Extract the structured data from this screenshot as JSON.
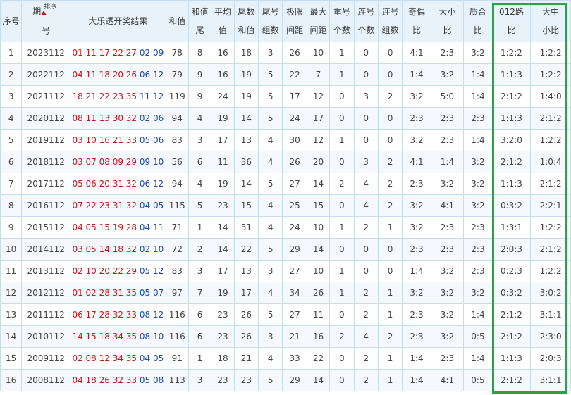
{
  "headers": [
    [
      "序号"
    ],
    [
      "期",
      "号"
    ],
    [
      "大乐透开奖结果"
    ],
    [
      "和值"
    ],
    [
      "和值",
      "尾"
    ],
    [
      "平均",
      "值"
    ],
    [
      "尾数",
      "和值"
    ],
    [
      "尾号",
      "组数"
    ],
    [
      "极限",
      "间距"
    ],
    [
      "最大",
      "间距"
    ],
    [
      "重号",
      "个数"
    ],
    [
      "连号",
      "个数"
    ],
    [
      "连号",
      "组数"
    ],
    [
      "奇偶",
      "比"
    ],
    [
      "大小",
      "比"
    ],
    [
      "质合",
      "比"
    ],
    [
      "012路",
      "比"
    ],
    [
      "大中",
      "小比"
    ]
  ],
  "sort_label": "排序",
  "rows": [
    {
      "no": "1",
      "issue": "2023112",
      "red": "01 11 17 22 27",
      "blue": "02 09",
      "sum": "78",
      "sum_tail": "8",
      "avg": "16",
      "tail_sum": "18",
      "tail_groups": "3",
      "limit_gap": "26",
      "max_gap": "10",
      "repeat": "1",
      "consec": "0",
      "consec_groups": "0",
      "odd_even": "4:1",
      "big_small": "2:3",
      "prime": "3:2",
      "r012": "1:2:2",
      "bms": "1:2:2"
    },
    {
      "no": "2",
      "issue": "2022112",
      "red": "04 11 18 20 26",
      "blue": "06 12",
      "sum": "79",
      "sum_tail": "9",
      "avg": "16",
      "tail_sum": "19",
      "tail_groups": "5",
      "limit_gap": "22",
      "max_gap": "7",
      "repeat": "1",
      "consec": "0",
      "consec_groups": "0",
      "odd_even": "1:4",
      "big_small": "3:2",
      "prime": "1:4",
      "r012": "1:1:3",
      "bms": "1:2:2"
    },
    {
      "no": "3",
      "issue": "2021112",
      "red": "18 21 22 23 35",
      "blue": "11 12",
      "sum": "119",
      "sum_tail": "9",
      "avg": "24",
      "tail_sum": "19",
      "tail_groups": "5",
      "limit_gap": "17",
      "max_gap": "12",
      "repeat": "0",
      "consec": "3",
      "consec_groups": "2",
      "odd_even": "3:2",
      "big_small": "5:0",
      "prime": "1:4",
      "r012": "2:1:2",
      "bms": "1:4:0"
    },
    {
      "no": "4",
      "issue": "2020112",
      "red": "08 11 13 30 32",
      "blue": "02 06",
      "sum": "94",
      "sum_tail": "4",
      "avg": "19",
      "tail_sum": "14",
      "tail_groups": "5",
      "limit_gap": "24",
      "max_gap": "17",
      "repeat": "0",
      "consec": "0",
      "consec_groups": "0",
      "odd_even": "2:3",
      "big_small": "2:3",
      "prime": "2:3",
      "r012": "1:1:3",
      "bms": "2:1:2"
    },
    {
      "no": "5",
      "issue": "2019112",
      "red": "03 10 16 21 33",
      "blue": "05 06",
      "sum": "83",
      "sum_tail": "3",
      "avg": "17",
      "tail_sum": "13",
      "tail_groups": "4",
      "limit_gap": "30",
      "max_gap": "12",
      "repeat": "1",
      "consec": "0",
      "consec_groups": "0",
      "odd_even": "3:2",
      "big_small": "2:3",
      "prime": "1:4",
      "r012": "3:2:0",
      "bms": "1:2:2"
    },
    {
      "no": "6",
      "issue": "2018112",
      "red": "03 07 08 09 29",
      "blue": "09 10",
      "sum": "56",
      "sum_tail": "6",
      "avg": "11",
      "tail_sum": "36",
      "tail_groups": "4",
      "limit_gap": "26",
      "max_gap": "20",
      "repeat": "0",
      "consec": "3",
      "consec_groups": "2",
      "odd_even": "4:1",
      "big_small": "1:4",
      "prime": "3:2",
      "r012": "2:1:2",
      "bms": "1:0:4"
    },
    {
      "no": "7",
      "issue": "2017112",
      "red": "05 06 20 31 32",
      "blue": "06 12",
      "sum": "94",
      "sum_tail": "4",
      "avg": "19",
      "tail_sum": "14",
      "tail_groups": "5",
      "limit_gap": "27",
      "max_gap": "14",
      "repeat": "2",
      "consec": "4",
      "consec_groups": "2",
      "odd_even": "2:3",
      "big_small": "3:2",
      "prime": "3:2",
      "r012": "1:1:3",
      "bms": "2:1:2"
    },
    {
      "no": "8",
      "issue": "2016112",
      "red": "07 22 23 31 32",
      "blue": "04 05",
      "sum": "115",
      "sum_tail": "5",
      "avg": "23",
      "tail_sum": "15",
      "tail_groups": "4",
      "limit_gap": "25",
      "max_gap": "15",
      "repeat": "0",
      "consec": "4",
      "consec_groups": "2",
      "odd_even": "3:2",
      "big_small": "4:1",
      "prime": "3:2",
      "r012": "0:3:2",
      "bms": "2:2:1"
    },
    {
      "no": "9",
      "issue": "2015112",
      "red": "04 05 15 19 28",
      "blue": "04 11",
      "sum": "71",
      "sum_tail": "1",
      "avg": "14",
      "tail_sum": "31",
      "tail_groups": "4",
      "limit_gap": "24",
      "max_gap": "10",
      "repeat": "1",
      "consec": "2",
      "consec_groups": "1",
      "odd_even": "3:2",
      "big_small": "2:3",
      "prime": "2:3",
      "r012": "1:3:1",
      "bms": "1:2:2"
    },
    {
      "no": "10",
      "issue": "2014112",
      "red": "03 05 14 18 32",
      "blue": "02 10",
      "sum": "72",
      "sum_tail": "2",
      "avg": "14",
      "tail_sum": "22",
      "tail_groups": "5",
      "limit_gap": "29",
      "max_gap": "14",
      "repeat": "0",
      "consec": "0",
      "consec_groups": "0",
      "odd_even": "2:3",
      "big_small": "2:3",
      "prime": "2:3",
      "r012": "2:0:3",
      "bms": "2:1:2"
    },
    {
      "no": "11",
      "issue": "2013112",
      "red": "02 10 20 22 29",
      "blue": "05 12",
      "sum": "83",
      "sum_tail": "3",
      "avg": "17",
      "tail_sum": "13",
      "tail_groups": "3",
      "limit_gap": "27",
      "max_gap": "10",
      "repeat": "1",
      "consec": "0",
      "consec_groups": "0",
      "odd_even": "1:4",
      "big_small": "3:2",
      "prime": "2:3",
      "r012": "0:2:3",
      "bms": "1:2:2"
    },
    {
      "no": "12",
      "issue": "2012112",
      "red": "01 02 28 31 35",
      "blue": "05 07",
      "sum": "97",
      "sum_tail": "7",
      "avg": "19",
      "tail_sum": "17",
      "tail_groups": "4",
      "limit_gap": "34",
      "max_gap": "26",
      "repeat": "1",
      "consec": "2",
      "consec_groups": "1",
      "odd_even": "3:2",
      "big_small": "3:2",
      "prime": "3:2",
      "r012": "0:3:2",
      "bms": "3:0:2"
    },
    {
      "no": "13",
      "issue": "2011112",
      "red": "06 17 28 32 33",
      "blue": "08 12",
      "sum": "116",
      "sum_tail": "6",
      "avg": "23",
      "tail_sum": "26",
      "tail_groups": "5",
      "limit_gap": "27",
      "max_gap": "11",
      "repeat": "0",
      "consec": "2",
      "consec_groups": "1",
      "odd_even": "2:3",
      "big_small": "3:2",
      "prime": "1:4",
      "r012": "2:1:2",
      "bms": "3:1:1"
    },
    {
      "no": "14",
      "issue": "2010112",
      "red": "14 15 18 34 35",
      "blue": "08 10",
      "sum": "116",
      "sum_tail": "6",
      "avg": "23",
      "tail_sum": "26",
      "tail_groups": "3",
      "limit_gap": "21",
      "max_gap": "16",
      "repeat": "2",
      "consec": "4",
      "consec_groups": "2",
      "odd_even": "2:3",
      "big_small": "3:2",
      "prime": "0:5",
      "r012": "2:1:2",
      "bms": "2:3:0"
    },
    {
      "no": "15",
      "issue": "2009112",
      "red": "02 08 12 34 35",
      "blue": "04 05",
      "sum": "91",
      "sum_tail": "1",
      "avg": "18",
      "tail_sum": "21",
      "tail_groups": "4",
      "limit_gap": "33",
      "max_gap": "22",
      "repeat": "0",
      "consec": "2",
      "consec_groups": "1",
      "odd_even": "1:4",
      "big_small": "2:3",
      "prime": "1:4",
      "r012": "1:1:3",
      "bms": "2:0:3"
    },
    {
      "no": "16",
      "issue": "2008112",
      "red": "04 18 26 32 33",
      "blue": "05 08",
      "sum": "113",
      "sum_tail": "3",
      "avg": "23",
      "tail_sum": "23",
      "tail_groups": "5",
      "limit_gap": "29",
      "max_gap": "14",
      "repeat": "0",
      "consec": "2",
      "consec_groups": "1",
      "odd_even": "1:4",
      "big_small": "4:1",
      "prime": "0:5",
      "r012": "2:1:2",
      "bms": "3:1:1"
    }
  ],
  "colors": {
    "red_ball": "#c8161d",
    "blue_ball": "#1f49a8",
    "highlight": "#2aa24a",
    "header_bg": "#e7f2fb",
    "border": "#c9dcec"
  }
}
